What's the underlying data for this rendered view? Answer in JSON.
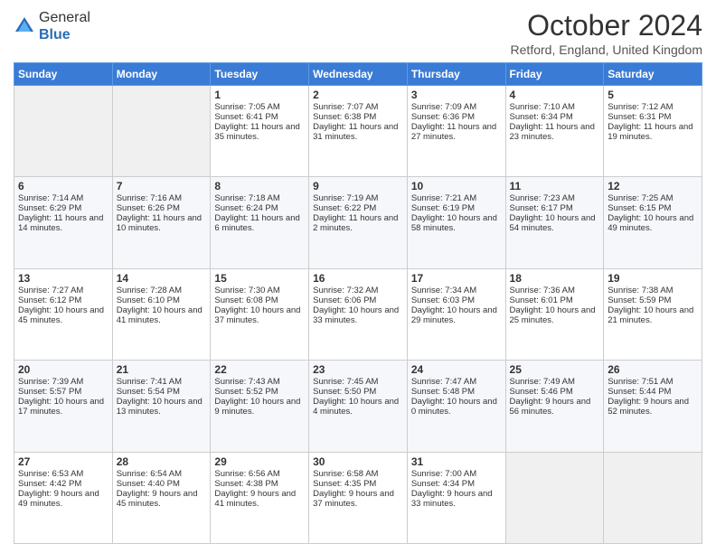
{
  "logo": {
    "general": "General",
    "blue": "Blue"
  },
  "header": {
    "month": "October 2024",
    "location": "Retford, England, United Kingdom"
  },
  "weekdays": [
    "Sunday",
    "Monday",
    "Tuesday",
    "Wednesday",
    "Thursday",
    "Friday",
    "Saturday"
  ],
  "weeks": [
    [
      {
        "day": "",
        "sunrise": "",
        "sunset": "",
        "daylight": ""
      },
      {
        "day": "",
        "sunrise": "",
        "sunset": "",
        "daylight": ""
      },
      {
        "day": "1",
        "sunrise": "Sunrise: 7:05 AM",
        "sunset": "Sunset: 6:41 PM",
        "daylight": "Daylight: 11 hours and 35 minutes."
      },
      {
        "day": "2",
        "sunrise": "Sunrise: 7:07 AM",
        "sunset": "Sunset: 6:38 PM",
        "daylight": "Daylight: 11 hours and 31 minutes."
      },
      {
        "day": "3",
        "sunrise": "Sunrise: 7:09 AM",
        "sunset": "Sunset: 6:36 PM",
        "daylight": "Daylight: 11 hours and 27 minutes."
      },
      {
        "day": "4",
        "sunrise": "Sunrise: 7:10 AM",
        "sunset": "Sunset: 6:34 PM",
        "daylight": "Daylight: 11 hours and 23 minutes."
      },
      {
        "day": "5",
        "sunrise": "Sunrise: 7:12 AM",
        "sunset": "Sunset: 6:31 PM",
        "daylight": "Daylight: 11 hours and 19 minutes."
      }
    ],
    [
      {
        "day": "6",
        "sunrise": "Sunrise: 7:14 AM",
        "sunset": "Sunset: 6:29 PM",
        "daylight": "Daylight: 11 hours and 14 minutes."
      },
      {
        "day": "7",
        "sunrise": "Sunrise: 7:16 AM",
        "sunset": "Sunset: 6:26 PM",
        "daylight": "Daylight: 11 hours and 10 minutes."
      },
      {
        "day": "8",
        "sunrise": "Sunrise: 7:18 AM",
        "sunset": "Sunset: 6:24 PM",
        "daylight": "Daylight: 11 hours and 6 minutes."
      },
      {
        "day": "9",
        "sunrise": "Sunrise: 7:19 AM",
        "sunset": "Sunset: 6:22 PM",
        "daylight": "Daylight: 11 hours and 2 minutes."
      },
      {
        "day": "10",
        "sunrise": "Sunrise: 7:21 AM",
        "sunset": "Sunset: 6:19 PM",
        "daylight": "Daylight: 10 hours and 58 minutes."
      },
      {
        "day": "11",
        "sunrise": "Sunrise: 7:23 AM",
        "sunset": "Sunset: 6:17 PM",
        "daylight": "Daylight: 10 hours and 54 minutes."
      },
      {
        "day": "12",
        "sunrise": "Sunrise: 7:25 AM",
        "sunset": "Sunset: 6:15 PM",
        "daylight": "Daylight: 10 hours and 49 minutes."
      }
    ],
    [
      {
        "day": "13",
        "sunrise": "Sunrise: 7:27 AM",
        "sunset": "Sunset: 6:12 PM",
        "daylight": "Daylight: 10 hours and 45 minutes."
      },
      {
        "day": "14",
        "sunrise": "Sunrise: 7:28 AM",
        "sunset": "Sunset: 6:10 PM",
        "daylight": "Daylight: 10 hours and 41 minutes."
      },
      {
        "day": "15",
        "sunrise": "Sunrise: 7:30 AM",
        "sunset": "Sunset: 6:08 PM",
        "daylight": "Daylight: 10 hours and 37 minutes."
      },
      {
        "day": "16",
        "sunrise": "Sunrise: 7:32 AM",
        "sunset": "Sunset: 6:06 PM",
        "daylight": "Daylight: 10 hours and 33 minutes."
      },
      {
        "day": "17",
        "sunrise": "Sunrise: 7:34 AM",
        "sunset": "Sunset: 6:03 PM",
        "daylight": "Daylight: 10 hours and 29 minutes."
      },
      {
        "day": "18",
        "sunrise": "Sunrise: 7:36 AM",
        "sunset": "Sunset: 6:01 PM",
        "daylight": "Daylight: 10 hours and 25 minutes."
      },
      {
        "day": "19",
        "sunrise": "Sunrise: 7:38 AM",
        "sunset": "Sunset: 5:59 PM",
        "daylight": "Daylight: 10 hours and 21 minutes."
      }
    ],
    [
      {
        "day": "20",
        "sunrise": "Sunrise: 7:39 AM",
        "sunset": "Sunset: 5:57 PM",
        "daylight": "Daylight: 10 hours and 17 minutes."
      },
      {
        "day": "21",
        "sunrise": "Sunrise: 7:41 AM",
        "sunset": "Sunset: 5:54 PM",
        "daylight": "Daylight: 10 hours and 13 minutes."
      },
      {
        "day": "22",
        "sunrise": "Sunrise: 7:43 AM",
        "sunset": "Sunset: 5:52 PM",
        "daylight": "Daylight: 10 hours and 9 minutes."
      },
      {
        "day": "23",
        "sunrise": "Sunrise: 7:45 AM",
        "sunset": "Sunset: 5:50 PM",
        "daylight": "Daylight: 10 hours and 4 minutes."
      },
      {
        "day": "24",
        "sunrise": "Sunrise: 7:47 AM",
        "sunset": "Sunset: 5:48 PM",
        "daylight": "Daylight: 10 hours and 0 minutes."
      },
      {
        "day": "25",
        "sunrise": "Sunrise: 7:49 AM",
        "sunset": "Sunset: 5:46 PM",
        "daylight": "Daylight: 9 hours and 56 minutes."
      },
      {
        "day": "26",
        "sunrise": "Sunrise: 7:51 AM",
        "sunset": "Sunset: 5:44 PM",
        "daylight": "Daylight: 9 hours and 52 minutes."
      }
    ],
    [
      {
        "day": "27",
        "sunrise": "Sunrise: 6:53 AM",
        "sunset": "Sunset: 4:42 PM",
        "daylight": "Daylight: 9 hours and 49 minutes."
      },
      {
        "day": "28",
        "sunrise": "Sunrise: 6:54 AM",
        "sunset": "Sunset: 4:40 PM",
        "daylight": "Daylight: 9 hours and 45 minutes."
      },
      {
        "day": "29",
        "sunrise": "Sunrise: 6:56 AM",
        "sunset": "Sunset: 4:38 PM",
        "daylight": "Daylight: 9 hours and 41 minutes."
      },
      {
        "day": "30",
        "sunrise": "Sunrise: 6:58 AM",
        "sunset": "Sunset: 4:35 PM",
        "daylight": "Daylight: 9 hours and 37 minutes."
      },
      {
        "day": "31",
        "sunrise": "Sunrise: 7:00 AM",
        "sunset": "Sunset: 4:34 PM",
        "daylight": "Daylight: 9 hours and 33 minutes."
      },
      {
        "day": "",
        "sunrise": "",
        "sunset": "",
        "daylight": ""
      },
      {
        "day": "",
        "sunrise": "",
        "sunset": "",
        "daylight": ""
      }
    ]
  ]
}
